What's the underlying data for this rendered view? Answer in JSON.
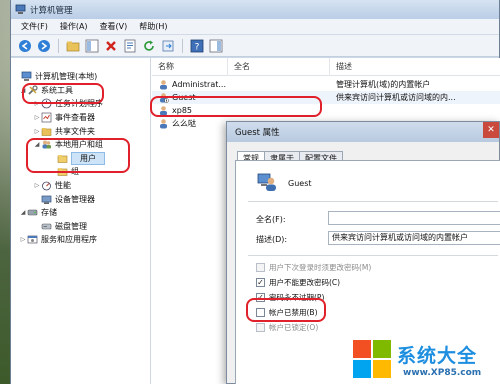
{
  "window": {
    "title": "计算机管理"
  },
  "menu": [
    "文件(F)",
    "操作(A)",
    "查看(V)",
    "帮助(H)"
  ],
  "toolbar_icons": [
    "back-icon",
    "forward-icon",
    "up-folder-icon",
    "show-tree-icon",
    "delete-icon",
    "properties-icon",
    "refresh-icon",
    "export-icon",
    "help-icon",
    "action-pane-icon"
  ],
  "tree": [
    {
      "label": "计算机管理(本地)",
      "icon": "computer-icon",
      "expander": ""
    },
    {
      "label": "系统工具",
      "icon": "tools-icon",
      "expander": "◢"
    },
    {
      "label": "任务计划程序",
      "icon": "task-scheduler-icon",
      "expander": "▷"
    },
    {
      "label": "事件查看器",
      "icon": "event-viewer-icon",
      "expander": "▷"
    },
    {
      "label": "共享文件夹",
      "icon": "shared-folder-icon",
      "expander": "▷"
    },
    {
      "label": "本地用户和组",
      "icon": "users-icon",
      "expander": "◢"
    },
    {
      "label": "用户",
      "icon": "folder-icon",
      "expander": ""
    },
    {
      "label": "组",
      "icon": "folder-icon",
      "expander": ""
    },
    {
      "label": "性能",
      "icon": "performance-icon",
      "expander": "▷"
    },
    {
      "label": "设备管理器",
      "icon": "device-manager-icon",
      "expander": ""
    },
    {
      "label": "存储",
      "icon": "storage-icon",
      "expander": "◢"
    },
    {
      "label": "磁盘管理",
      "icon": "disk-icon",
      "expander": ""
    },
    {
      "label": "服务和应用程序",
      "icon": "services-icon",
      "expander": "▷"
    }
  ],
  "list": {
    "columns": [
      "名称",
      "全名",
      "描述"
    ],
    "rows": [
      {
        "name": "Administrat...",
        "fullname": "",
        "desc": "管理计算机(域)的内置帐户"
      },
      {
        "name": "Guest",
        "fullname": "",
        "desc": "供来宾访问计算机或访问域的内..."
      },
      {
        "name": "xp85",
        "fullname": "",
        "desc": ""
      },
      {
        "name": "么么哒",
        "fullname": "",
        "desc": ""
      }
    ]
  },
  "dialog": {
    "title": "Guest 属性",
    "close": "✕",
    "tabs": [
      "常规",
      "隶属于",
      "配置文件"
    ],
    "username": "Guest",
    "fullname_label": "全名(F):",
    "fullname_value": "",
    "desc_label": "描述(D):",
    "desc_value": "供来宾访问计算机或访问域的内置帐户",
    "checkboxes": [
      {
        "label": "用户下次登录时须更改密码(M)",
        "checked": false,
        "disabled": true
      },
      {
        "label": "用户不能更改密码(C)",
        "checked": true,
        "disabled": false
      },
      {
        "label": "密码永不过期(P)",
        "checked": true,
        "disabled": false
      },
      {
        "label": "帐户已禁用(B)",
        "checked": false,
        "disabled": false
      },
      {
        "label": "帐户已锁定(O)",
        "checked": false,
        "disabled": true
      }
    ]
  },
  "watermark": {
    "title": "系统大全",
    "url": "www.XP85.com"
  },
  "colors": {
    "highlight": "#e0202a",
    "watermark": "#1d8ee0"
  }
}
